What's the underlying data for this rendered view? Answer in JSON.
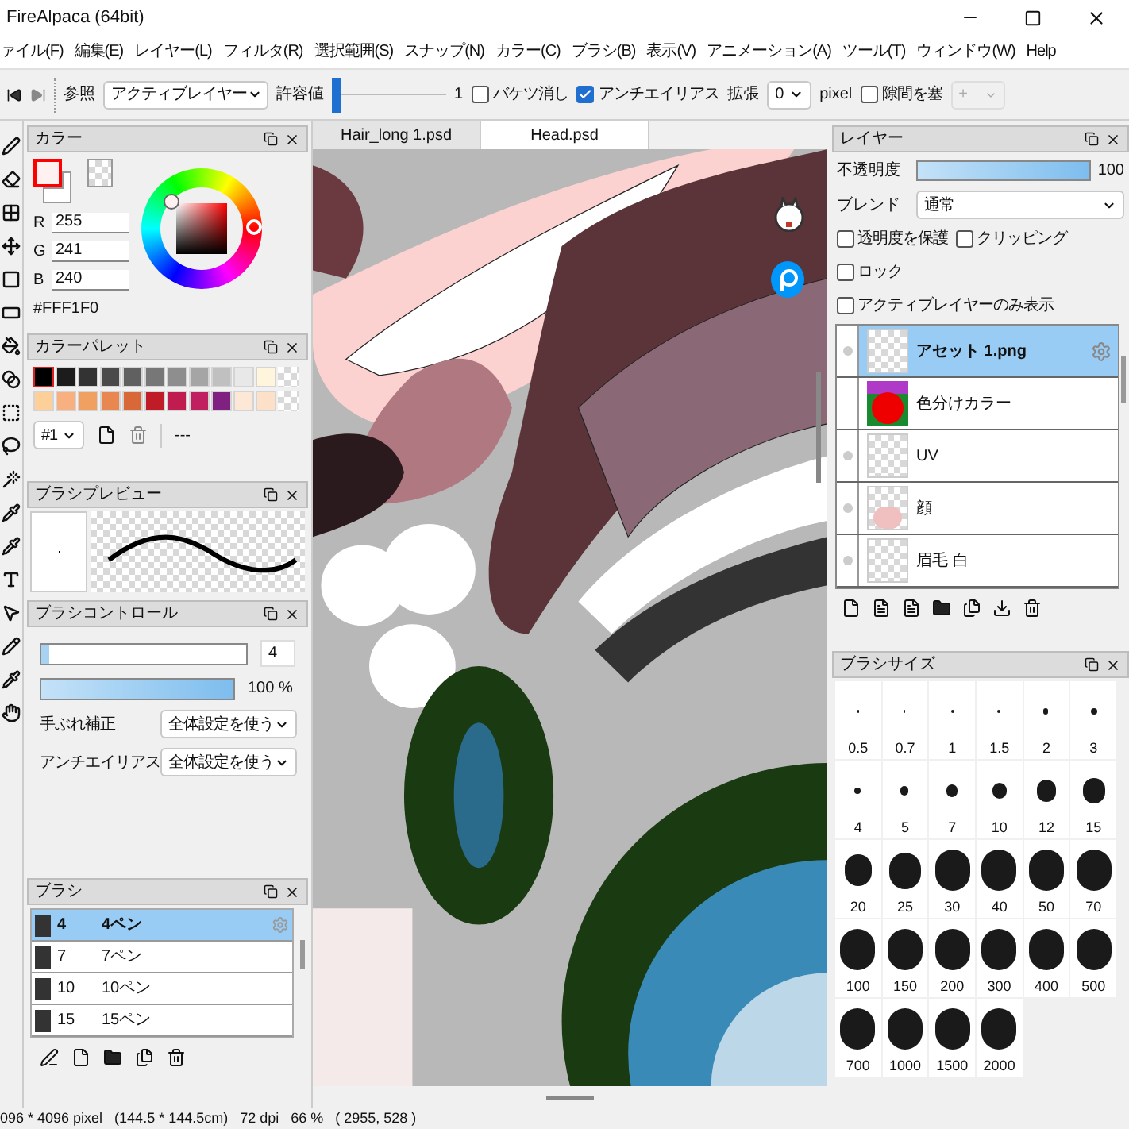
{
  "window": {
    "title": "FireAlpaca (64bit)"
  },
  "menu": [
    "ァイル(F)",
    "編集(E)",
    "レイヤー(L)",
    "フィルタ(R)",
    "選択範囲(S)",
    "スナップ(N)",
    "カラー(C)",
    "ブラシ(B)",
    "表示(V)",
    "アニメーション(A)",
    "ツール(T)",
    "ウィンドウ(W)",
    "Help"
  ],
  "toolbar": {
    "reference_label": "参照",
    "reference_select": "アクティブレイヤー",
    "tolerance_label": "許容値",
    "tolerance": {
      "level": 0
    },
    "tolerance_value": "1",
    "checkboxes": [
      {
        "label": "バケツ消し",
        "checked": false
      },
      {
        "label": "アンチエイリアス",
        "checked": true
      }
    ],
    "expand_label": "拡張",
    "expand_select": "0",
    "expand_unit": "pixel",
    "gap_fill": {
      "label": "隙間を塞",
      "checked": false
    },
    "gap_select": "+"
  },
  "color_panel": {
    "title": "カラー",
    "color": "#fff1f0",
    "channels": [
      {
        "label": "R",
        "value": "255"
      },
      {
        "label": "G",
        "value": "241"
      },
      {
        "label": "B",
        "value": "240"
      }
    ],
    "hex": "#FFF1F0"
  },
  "palette": {
    "title": "カラーパレット",
    "rows": [
      [
        {
          "color": "#000000",
          "selected": true
        },
        {
          "color": "#1c1c1c",
          "selected": false
        },
        {
          "color": "#333333",
          "selected": false
        },
        {
          "color": "#4a4a4a",
          "selected": false
        },
        {
          "color": "#606060",
          "selected": false
        },
        {
          "color": "#777777",
          "selected": false
        },
        {
          "color": "#8e8e8e",
          "selected": false
        },
        {
          "color": "#a5a5a5",
          "selected": false
        },
        {
          "color": "#c0c0c0",
          "selected": false
        },
        {
          "color": "#e8e8e8",
          "selected": false
        },
        {
          "color": "#fff5dc",
          "selected": false
        }
      ],
      [
        {
          "color": "#fdd09a",
          "selected": false
        },
        {
          "color": "#f8b080",
          "selected": false
        },
        {
          "color": "#f0a060",
          "selected": false
        },
        {
          "color": "#e88850",
          "selected": false
        },
        {
          "color": "#d86838",
          "selected": false
        },
        {
          "color": "#c01c28",
          "selected": false
        },
        {
          "color": "#c01c50",
          "selected": false
        },
        {
          "color": "#c02060",
          "selected": false
        },
        {
          "color": "#802080",
          "selected": false
        },
        {
          "color": "#fde8d8",
          "selected": false
        },
        {
          "color": "#fde0c8",
          "selected": false
        }
      ]
    ],
    "set": "#1",
    "name": "---"
  },
  "brush_preview": {
    "title": "ブラシプレビュー"
  },
  "brush_control": {
    "title": "ブラシコントロール",
    "size": {
      "level": 0.04,
      "value": "4"
    },
    "opacity": {
      "level": 1,
      "value": "100 %"
    },
    "settings": [
      {
        "label": "手ぶれ補正",
        "value": "全体設定を使う"
      },
      {
        "label": "アンチエイリアス",
        "value": "全体設定を使う"
      }
    ]
  },
  "brushes": {
    "title": "ブラシ",
    "items": [
      {
        "size": "4",
        "name": "4ペン",
        "selected": true
      },
      {
        "size": "7",
        "name": "7ペン",
        "selected": false
      },
      {
        "size": "10",
        "name": "10ペン",
        "selected": false
      },
      {
        "size": "15",
        "name": "15ペン",
        "selected": false
      }
    ]
  },
  "canvas": {
    "tabs": [
      {
        "label": "Hair_long 1.psd",
        "selected": false
      },
      {
        "label": "Head.psd",
        "selected": true
      }
    ]
  },
  "layers": {
    "title": "レイヤー",
    "opacity_label": "不透明度",
    "opacity": {
      "level": 1
    },
    "opacity_value": "100",
    "blend_label": "ブレンド",
    "blend": "通常",
    "options": [
      {
        "label": "透明度を保護",
        "checked": false
      },
      {
        "label": "クリッピング",
        "checked": false
      },
      {
        "label": "ロック",
        "checked": false
      },
      {
        "label": "アクティブレイヤーのみ表示",
        "checked": false
      }
    ],
    "items": [
      {
        "name": "アセット 1.png",
        "visible": true,
        "selected": true,
        "kind": "empty"
      },
      {
        "name": "色分けカラー",
        "visible": false,
        "selected": false,
        "kind": "colormap"
      },
      {
        "name": "UV",
        "visible": true,
        "selected": false,
        "kind": "empty"
      },
      {
        "name": "顔",
        "visible": true,
        "selected": false,
        "kind": "face"
      },
      {
        "name": "眉毛 白",
        "visible": true,
        "selected": false,
        "kind": "empty"
      }
    ]
  },
  "brush_size": {
    "title": "ブラシサイズ",
    "sizes": [
      "0.5",
      "0.7",
      "1",
      "1.5",
      "2",
      "3",
      "4",
      "5",
      "7",
      "10",
      "12",
      "15",
      "20",
      "25",
      "30",
      "40",
      "50",
      "70",
      "100",
      "150",
      "200",
      "300",
      "400",
      "500",
      "700",
      "1000",
      "1500",
      "2000"
    ]
  },
  "status_bar": "096 * 4096 pixel   (144.5 * 144.5cm)   72 dpi   66 %   ( 2955, 528 )"
}
